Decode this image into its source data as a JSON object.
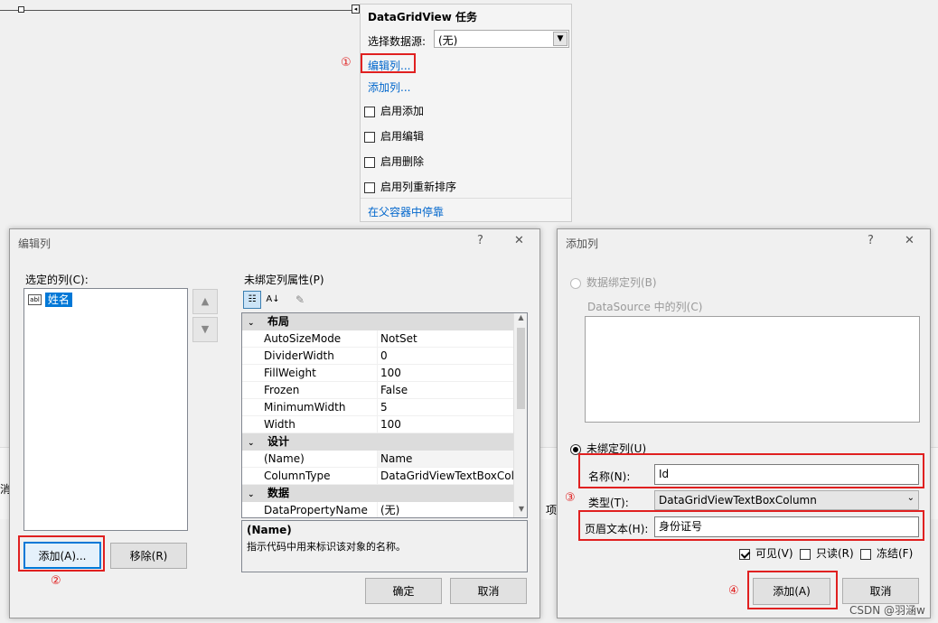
{
  "designer": {
    "bottom_left_text": "消",
    "bottom_right_text": "项"
  },
  "tasks_panel": {
    "title": "DataGridView 任务",
    "datasource_label": "选择数据源:",
    "datasource_value": "(无)",
    "edit_columns": "编辑列...",
    "add_column": "添加列...",
    "checks": [
      {
        "label": "启用添加",
        "checked": false
      },
      {
        "label": "启用编辑",
        "checked": false
      },
      {
        "label": "启用删除",
        "checked": false
      },
      {
        "label": "启用列重新排序",
        "checked": false
      }
    ],
    "dock": "在父容器中停靠"
  },
  "edit_dialog": {
    "title": "编辑列",
    "help": "?",
    "close": "✕",
    "selected_label": "选定的列(C):",
    "selected_items": [
      {
        "icon_text": "abl",
        "name": "姓名"
      }
    ],
    "props_label": "未绑定列属性(P)",
    "categories": [
      {
        "name": "布局",
        "rows": [
          {
            "k": "AutoSizeMode",
            "v": "NotSet"
          },
          {
            "k": "DividerWidth",
            "v": "0"
          },
          {
            "k": "FillWeight",
            "v": "100"
          },
          {
            "k": "Frozen",
            "v": "False"
          },
          {
            "k": "MinimumWidth",
            "v": "5"
          },
          {
            "k": "Width",
            "v": "100"
          }
        ]
      },
      {
        "name": "设计",
        "rows": [
          {
            "k": "(Name)",
            "v": "Name"
          },
          {
            "k": "ColumnType",
            "v": "DataGridViewTextBoxColu"
          }
        ]
      },
      {
        "name": "数据",
        "rows": [
          {
            "k": "DataPropertyName",
            "v": "(无)"
          }
        ]
      }
    ],
    "desc_title": "(Name)",
    "desc_text": "指示代码中用来标识该对象的名称。",
    "add_btn": "添加(A)...",
    "remove_btn": "移除(R)",
    "ok_btn": "确定",
    "cancel_btn": "取消"
  },
  "add_dialog": {
    "title": "添加列",
    "help": "?",
    "close": "✕",
    "databound_label": "数据绑定列(B)",
    "datasource_cols_label": "DataSource 中的列(C)",
    "unbound_label": "未绑定列(U)",
    "name_label": "名称(N):",
    "name_value": "Id",
    "type_label": "类型(T):",
    "type_value": "DataGridViewTextBoxColumn",
    "header_label": "页眉文本(H):",
    "header_value": "身份证号",
    "visible_label": "可见(V)",
    "readonly_label": "只读(R)",
    "frozen_label": "冻结(F)",
    "add_btn": "添加(A)",
    "cancel_btn": "取消"
  },
  "markers": [
    "①",
    "②",
    "③",
    "④"
  ],
  "watermark": "CSDN @羽涵w",
  "colors": {
    "accent": "#0078d7",
    "annotation_red": "#e02020",
    "link": "#0066cc"
  }
}
